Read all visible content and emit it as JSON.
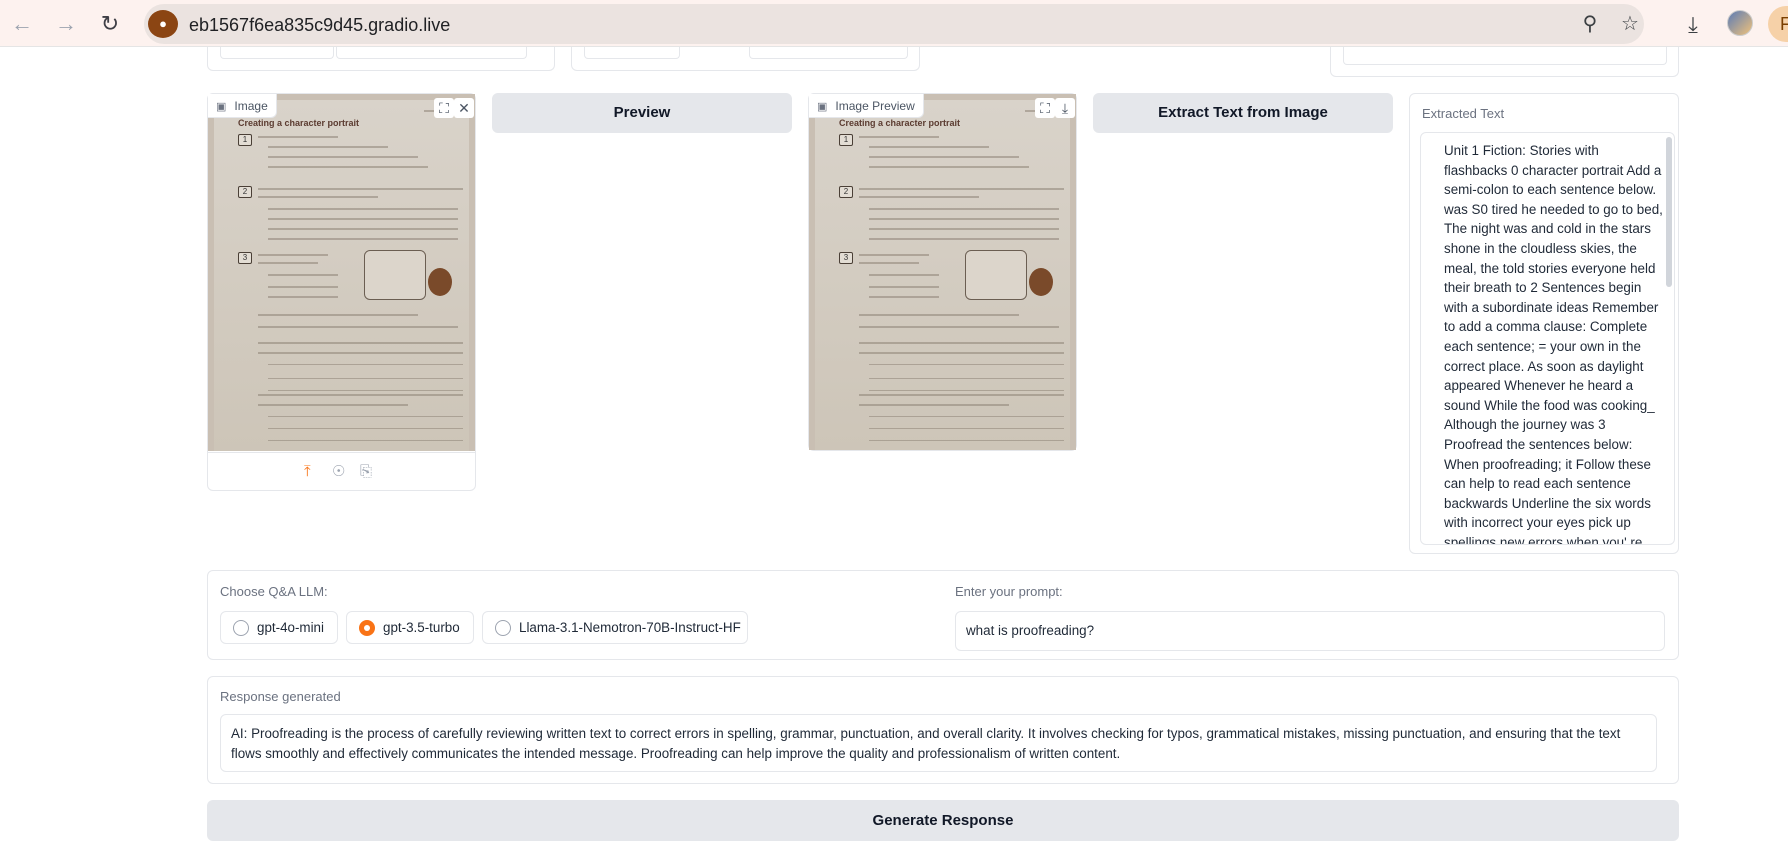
{
  "browser": {
    "url": "eb1567f6ea835c9d45.gradio.live",
    "profile_initial": "F"
  },
  "image_input": {
    "label": "Image"
  },
  "preview_button": {
    "label": "Preview"
  },
  "image_preview": {
    "label": "Image Preview"
  },
  "document": {
    "heading": "Creating a character portrait",
    "numbers": [
      "1",
      "2",
      "3"
    ]
  },
  "extract_button": {
    "label": "Extract Text from Image"
  },
  "extracted_text": {
    "label": "Extracted Text",
    "value": "Unit 1 Fiction: Stories with flashbacks 0 character portrait Add a semi-colon to each sentence below. was S0 tired he needed to go to bed, The night was and cold in the stars shone in the cloudless skies, the meal, the told stories everyone held their breath to 2 Sentences begin with a subordinate ideas Remember to add a comma clause: Complete each sentence; = your own in the correct place. As soon as daylight appeared  Whenever he heard a sound While the food was cooking_ Although the journey was 3 Proofread the sentences below: When proofreading; it Follow these can help to read each sentence backwards Underline the six words with incorrect your eyes pick up spellings new errors when you' re Add the missing punctuation: you not focusing on the"
  },
  "llm_choice": {
    "label": "Choose Q&A LLM:",
    "options": [
      "gpt-4o-mini",
      "gpt-3.5-turbo",
      "Llama-3.1-Nemotron-70B-Instruct-HF"
    ],
    "selected": "gpt-3.5-turbo"
  },
  "prompt": {
    "label": "Enter your prompt:",
    "value": "what is proofreading?"
  },
  "response": {
    "label": "Response generated",
    "value": "AI: Proofreading is the process of carefully reviewing written text to correct errors in spelling, grammar, punctuation, and overall clarity. It involves checking for typos, grammatical mistakes, missing punctuation, and ensuring that the text flows smoothly and effectively communicates the intended message. Proofreading can help improve the quality and professionalism of written content."
  },
  "generate_button": {
    "label": "Generate Response"
  },
  "colors": {
    "accent": "#f97316",
    "button_bg": "#e5e7eb",
    "border": "#e5e7eb"
  }
}
